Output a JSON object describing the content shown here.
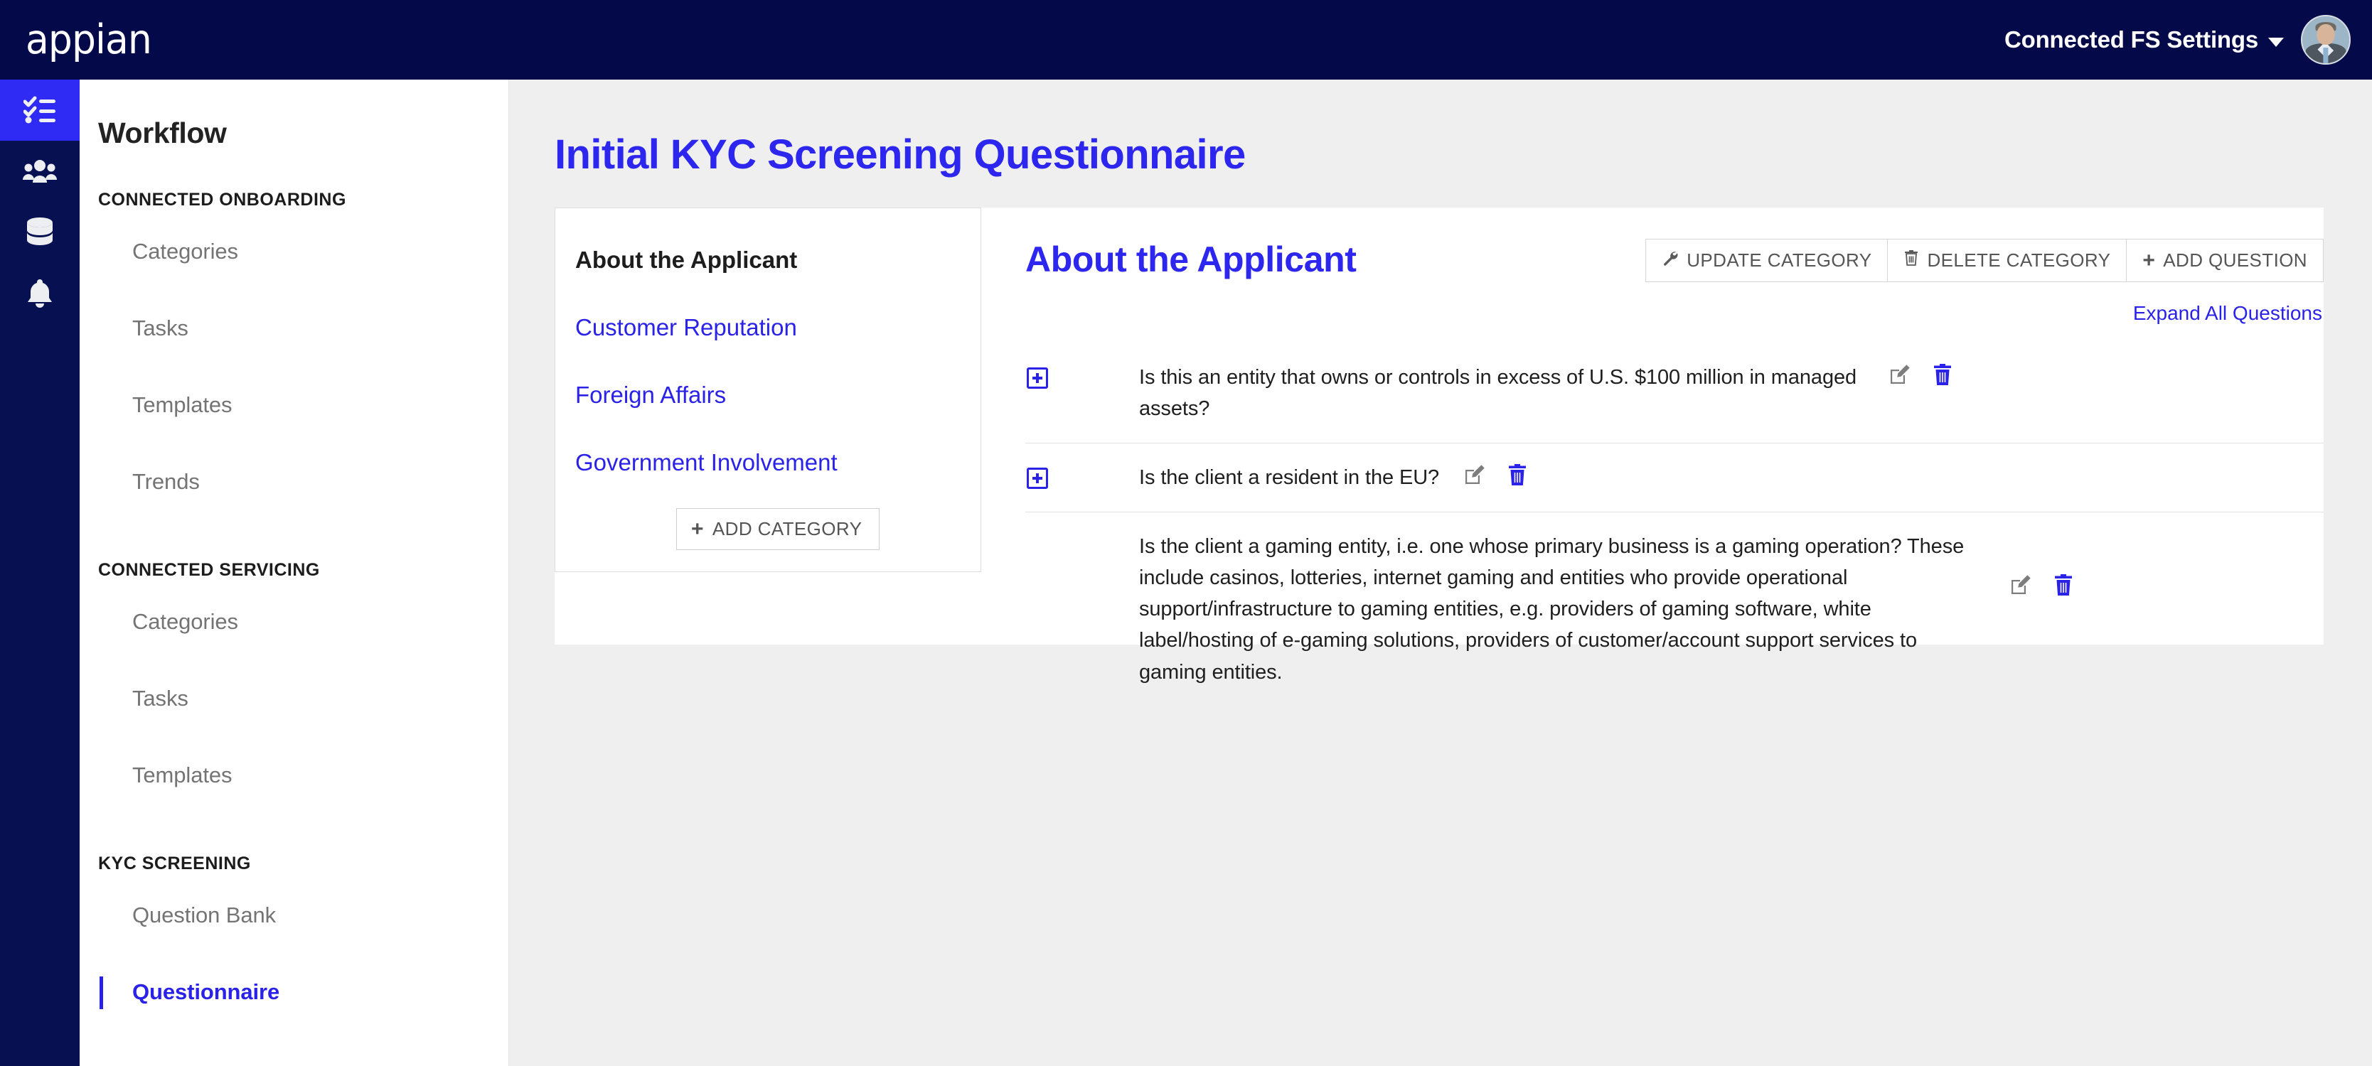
{
  "topbar": {
    "logo_text": "appian",
    "settings_label": "Connected FS Settings",
    "caret_icon": "chevron-down-icon",
    "avatar_icon": "user-avatar-photo"
  },
  "rail": {
    "items": [
      {
        "icon": "checklist-icon",
        "active": true
      },
      {
        "icon": "users-icon",
        "active": false
      },
      {
        "icon": "database-icon",
        "active": false
      },
      {
        "icon": "bell-icon",
        "active": false
      }
    ]
  },
  "sidebar": {
    "title": "Workflow",
    "groups": [
      {
        "label": "CONNECTED ONBOARDING",
        "items": [
          {
            "label": "Categories",
            "active": false
          },
          {
            "label": "Tasks",
            "active": false
          },
          {
            "label": "Templates",
            "active": false
          },
          {
            "label": "Trends",
            "active": false
          }
        ]
      },
      {
        "label": "CONNECTED SERVICING",
        "items": [
          {
            "label": "Categories",
            "active": false
          },
          {
            "label": "Tasks",
            "active": false
          },
          {
            "label": "Templates",
            "active": false
          }
        ]
      },
      {
        "label": "KYC SCREENING",
        "items": [
          {
            "label": "Question Bank",
            "active": false
          },
          {
            "label": "Questionnaire",
            "active": true
          }
        ]
      }
    ]
  },
  "main": {
    "page_title": "Initial KYC Screening Questionnaire",
    "categories": {
      "selected": "About the Applicant",
      "links": [
        "Customer Reputation",
        "Foreign Affairs",
        "Government Involvement"
      ],
      "add_button": {
        "label": "ADD CATEGORY",
        "icon": "plus-icon"
      }
    },
    "questions_panel": {
      "heading": "About the Applicant",
      "buttons": [
        {
          "label": "UPDATE CATEGORY",
          "icon": "wrench-icon"
        },
        {
          "label": "DELETE CATEGORY",
          "icon": "trash-icon"
        },
        {
          "label": "ADD QUESTION",
          "icon": "plus-icon"
        }
      ],
      "expand_all_label": "Expand All Questions",
      "row_actions": {
        "edit_icon": "edit-pencil-icon",
        "delete_icon": "trash-icon"
      },
      "expand_icon": "plus-square-icon",
      "questions": [
        {
          "text": "Is this an entity that owns or controls in excess of U.S. $100 million in managed assets?",
          "expandable": true
        },
        {
          "text": "Is the client a resident in the EU?",
          "expandable": true
        },
        {
          "text": "Is the client a gaming entity, i.e. one whose primary business is a gaming operation? These include casinos, lotteries, internet gaming and entities who provide operational support/infrastructure to gaming entities, e.g. providers of gaming software, white label/hosting of e-gaming solutions, providers of customer/account support services to gaming entities.",
          "expandable": false
        }
      ]
    }
  },
  "colors": {
    "header_navy": "#04094a",
    "rail_navy": "#071151",
    "accent_blue": "#2b22e8",
    "rail_active_blue": "#2f2bf5",
    "page_bg": "#efefef",
    "card_white": "#ffffff",
    "muted_text": "#747474"
  }
}
